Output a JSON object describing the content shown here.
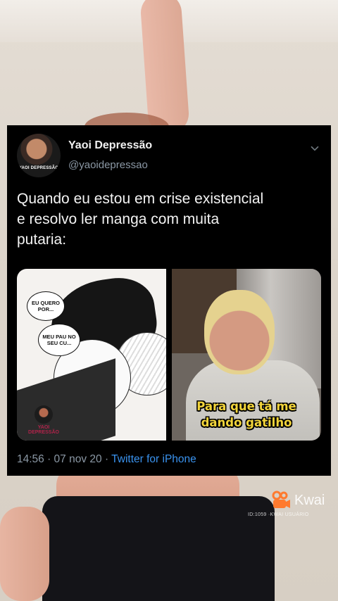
{
  "tweet": {
    "display_name": "Yaoi Depressão",
    "handle": "@yaoidepressao",
    "avatar_label": "YAOI DEPRESSÃO",
    "text": "Quando eu estou em crise existencial\ne resolvo ler manga com muita\nputaria:",
    "timestamp": "14:56 · 07 nov 20 · ",
    "source": "Twitter for iPhone"
  },
  "media": {
    "left": {
      "bubble1": "EU QUERO POR...",
      "bubble2": "MEU PAU NO SEU CU...",
      "watermark": "Yaoi DEPRESSÃO"
    },
    "right": {
      "caption": "Para que tá me\ndando gatilho"
    }
  },
  "overlay": {
    "kwai_label": "Kwai",
    "kwai_id": "ID:1059 ·KWAI USUÁRIO"
  },
  "icons": {
    "chevron": "chevron-down-icon",
    "kwai": "kwai-logo-icon"
  },
  "colors": {
    "tweet_bg": "#000000",
    "link_blue": "#3a93ef",
    "muted": "#8b98a5",
    "kwai_orange": "#ff7a2e",
    "caption_yellow": "#f2d43a"
  }
}
